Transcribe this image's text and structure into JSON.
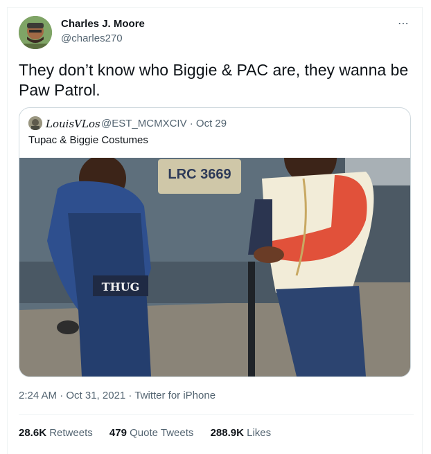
{
  "author": {
    "name": "Charles J. Moore",
    "handle": "@charles270"
  },
  "more_icon": "⋯",
  "tweet_text": "They don’t know who Biggie & PAC are, they wanna be Paw Patrol.",
  "quoted": {
    "name": "LouisVLos",
    "meta": "@EST_MCMXCIV · Oct 29",
    "text": "Tupac & Biggie Costumes",
    "plate": "LRC 3669",
    "sign": "THUG"
  },
  "timestamp": "2:24 AM · Oct 31, 2021 · Twitter for iPhone",
  "stats": {
    "retweets_num": "28.6K",
    "retweets_label": "Retweets",
    "quotes_num": "479",
    "quotes_label": "Quote Tweets",
    "likes_num": "288.9K",
    "likes_label": "Likes"
  },
  "colors": {
    "secondary_text": "#536471",
    "border": "#cfd9de",
    "sweater_red": "#e1513a"
  }
}
